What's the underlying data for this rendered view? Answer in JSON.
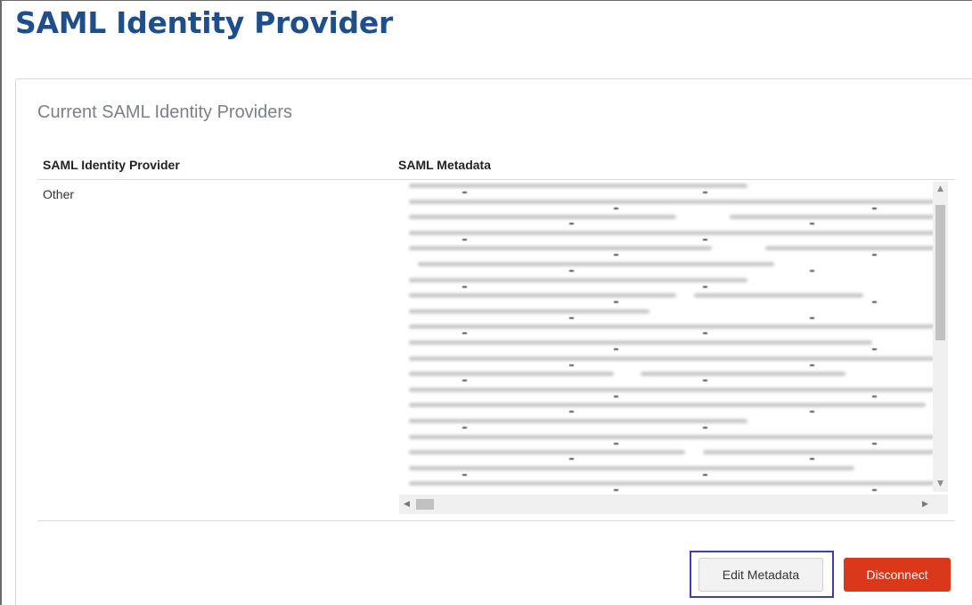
{
  "page": {
    "title": "SAML Identity Provider"
  },
  "panel": {
    "section_title": "Current SAML Identity Providers",
    "columns": [
      "SAML Identity Provider",
      "SAML Metadata"
    ],
    "rows": [
      {
        "provider": "Other",
        "metadata": ""
      }
    ]
  },
  "actions": {
    "edit_label": "Edit Metadata",
    "disconnect_label": "Disconnect"
  },
  "colors": {
    "title": "#1f4e8c",
    "disconnect": "#d9391a",
    "highlight": "#3b3fb0"
  },
  "icons": {
    "scroll_up": "triangle-up-icon",
    "scroll_down": "triangle-down-icon",
    "scroll_left": "triangle-left-icon",
    "scroll_right": "triangle-right-icon"
  }
}
